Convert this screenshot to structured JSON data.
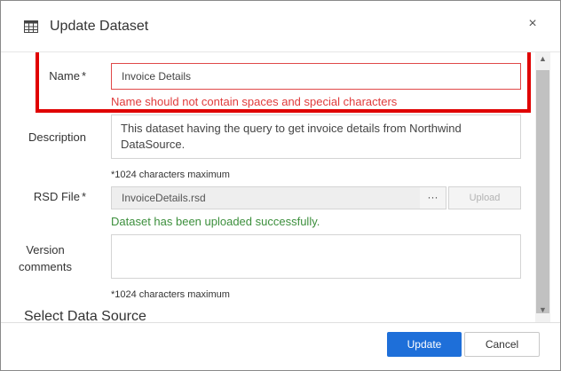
{
  "dialog": {
    "title": "Update Dataset",
    "close_glyph": "×",
    "title_icon": "table-icon"
  },
  "form": {
    "name_label": "Name",
    "name_required": "*",
    "name_value": "Invoice Details",
    "name_error": "Name should not contain spaces and special characters",
    "description_label": "Description",
    "description_value": "This dataset having the query to get invoice details from Northwind DataSource.",
    "description_hint": "*1024 characters maximum",
    "rsd_label": "RSD File",
    "rsd_required": "*",
    "rsd_value": "InvoiceDetails.rsd",
    "browse_label": "···",
    "upload_label": "Upload",
    "upload_success": "Dataset has been uploaded successfully.",
    "version_label_line1": "Version",
    "version_label_line2": "comments",
    "version_value": "",
    "version_hint": "*1024 characters maximum",
    "section_title": "Select Data Source"
  },
  "footer": {
    "update_label": "Update",
    "cancel_label": "Cancel"
  },
  "colors": {
    "primary": "#1e6fd9",
    "error": "#e03c3c",
    "success": "#3c8f3c",
    "highlight": "#e00000"
  }
}
